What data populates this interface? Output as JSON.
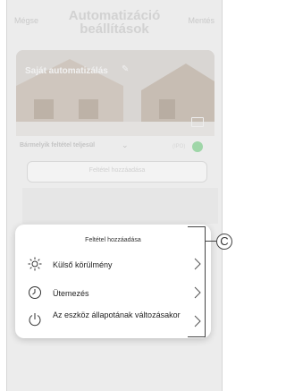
{
  "header": {
    "cancel_label": "Mégse",
    "title": "Automatizáció beállítások",
    "save_label": "Mentés"
  },
  "banner": {
    "name": "Saját automatizálás",
    "edit_icon": "pencil-icon",
    "image_icon": "image-icon"
  },
  "condition": {
    "mode_label": "Bármelyik feltétel teljesül",
    "dropdown_icon": "chevron-down-icon",
    "info_text": "(IPO)",
    "add_icon": "plus-circle-icon",
    "add_button_label": "Feltétel hozzáadása"
  },
  "sheet": {
    "title": "Feltétel hozzáadása",
    "options": [
      {
        "label": "Külső körülmény",
        "icon": "sun-icon"
      },
      {
        "label": "Ütemezés",
        "icon": "clock-icon"
      },
      {
        "label": "Az eszköz állapotának változásakor",
        "icon": "power-icon"
      }
    ]
  },
  "callout": {
    "label": "C"
  }
}
